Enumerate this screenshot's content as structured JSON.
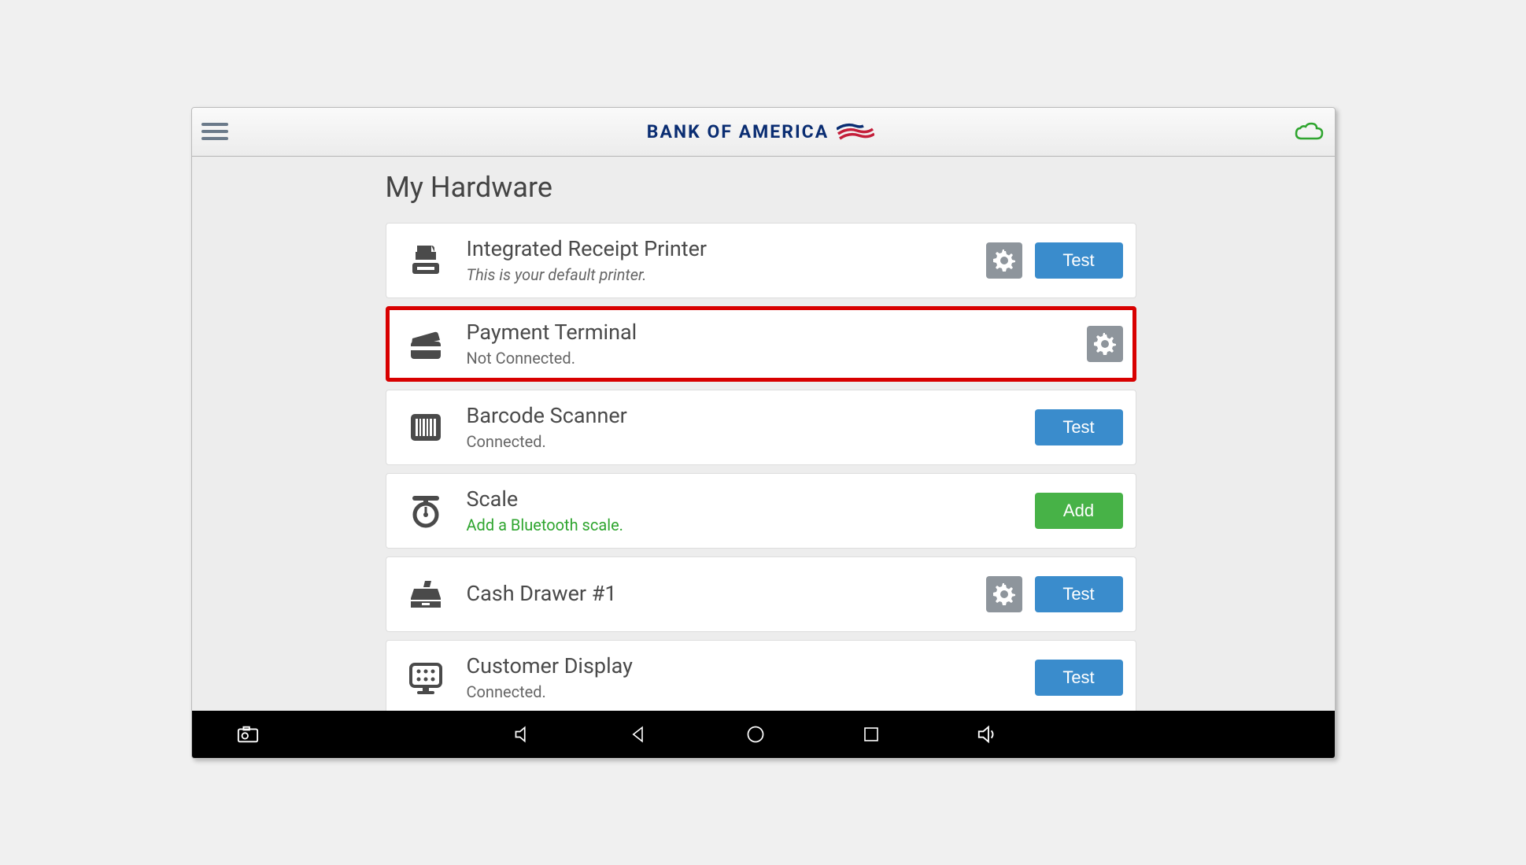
{
  "header": {
    "brand_text": "BANK OF AMERICA"
  },
  "page": {
    "title": "My Hardware"
  },
  "hardware": [
    {
      "title": "Integrated Receipt Printer",
      "subtitle": "This is your default printer.",
      "subtitle_style": "italic",
      "icon": "printer",
      "has_gear": true,
      "action_label": "Test",
      "action_style": "blue",
      "highlighted": false
    },
    {
      "title": "Payment Terminal",
      "subtitle": "Not Connected.",
      "subtitle_style": "normal",
      "icon": "card",
      "has_gear": true,
      "action_label": null,
      "action_style": null,
      "highlighted": true
    },
    {
      "title": "Barcode Scanner",
      "subtitle": "Connected.",
      "subtitle_style": "normal",
      "icon": "barcode",
      "has_gear": false,
      "action_label": "Test",
      "action_style": "blue",
      "highlighted": false
    },
    {
      "title": "Scale",
      "subtitle": "Add a Bluetooth scale.",
      "subtitle_style": "green",
      "icon": "scale",
      "has_gear": false,
      "action_label": "Add",
      "action_style": "green",
      "highlighted": false
    },
    {
      "title": "Cash Drawer #1",
      "subtitle": "",
      "subtitle_style": "normal",
      "icon": "drawer",
      "has_gear": true,
      "action_label": "Test",
      "action_style": "blue",
      "highlighted": false
    },
    {
      "title": "Customer Display",
      "subtitle": "Connected.",
      "subtitle_style": "normal",
      "icon": "display",
      "has_gear": false,
      "action_label": "Test",
      "action_style": "blue",
      "highlighted": false
    }
  ]
}
